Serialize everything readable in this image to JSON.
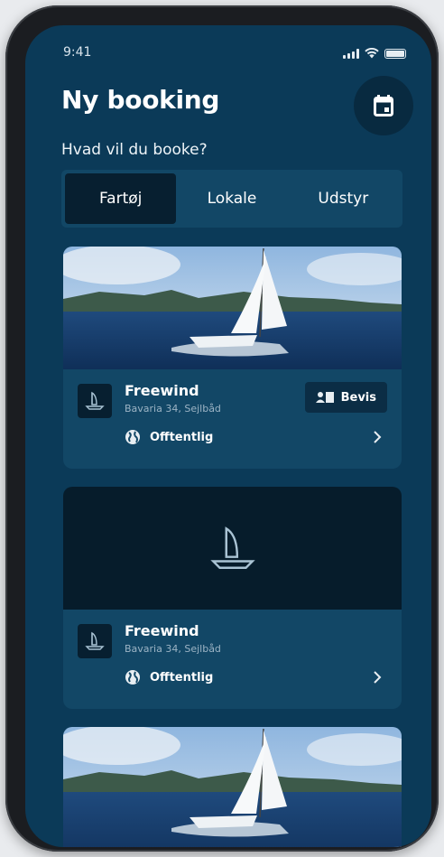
{
  "status": {
    "time": "9:41"
  },
  "header": {
    "title": "Ny booking"
  },
  "question": "Hvad vil du booke?",
  "tabs": [
    {
      "label": "Fartøj",
      "active": true
    },
    {
      "label": "Lokale",
      "active": false
    },
    {
      "label": "Udstyr",
      "active": false
    }
  ],
  "items": [
    {
      "name": "Freewind",
      "model": "Bavaria 34, Sejlbåd",
      "access": "Offtentlig",
      "badge": "Bevis",
      "has_photo": true
    },
    {
      "name": "Freewind",
      "model": "Bavaria 34, Sejlbåd",
      "access": "Offtentlig",
      "has_photo": false
    },
    {
      "has_photo": true
    }
  ],
  "colors": {
    "background": "#0b3a58",
    "card": "#124766",
    "active_tab": "#071f30",
    "muted_text": "#9cb4c5"
  },
  "icons": [
    "calendar-icon",
    "sailboat-icon",
    "globe-icon",
    "chevron-right-icon",
    "id-card-icon"
  ]
}
